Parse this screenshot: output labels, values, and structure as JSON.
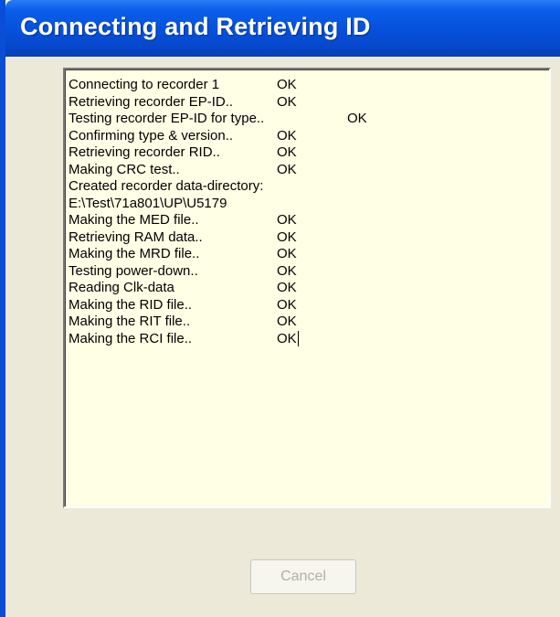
{
  "window": {
    "title": "Connecting and Retrieving ID"
  },
  "log": [
    {
      "text": "Connecting to recorder 1",
      "status": "OK"
    },
    {
      "text": "Retrieving recorder EP-ID..",
      "status": "OK"
    },
    {
      "text": "Testing recorder EP-ID for type..",
      "status": "OK"
    },
    {
      "text": "Confirming type & version..",
      "status": "OK"
    },
    {
      "text": "Retrieving recorder RID..",
      "status": "OK"
    },
    {
      "text": "Making CRC test..",
      "status": "OK"
    },
    {
      "text": "Created recorder data-directory:",
      "status": ""
    },
    {
      "text": "E:\\Test\\71a801\\UP\\U5179",
      "status": ""
    },
    {
      "text": "Making the MED file..",
      "status": "OK"
    },
    {
      "text": "Retrieving RAM data..",
      "status": "OK"
    },
    {
      "text": "Making the MRD file..",
      "status": "OK"
    },
    {
      "text": "Testing power-down..",
      "status": "OK"
    },
    {
      "text": "Reading Clk-data",
      "status": "OK"
    },
    {
      "text": "Making the RID file..",
      "status": "OK"
    },
    {
      "text": "Making the RIT file..",
      "status": "OK"
    },
    {
      "text": "Making the RCI file..",
      "status": "OK"
    }
  ],
  "buttons": {
    "cancel_label": "Cancel",
    "cancel_enabled": false
  },
  "colors": {
    "titlebar": "#0550db",
    "window_bg": "#ece9d8",
    "log_bg": "#ffffe6"
  }
}
